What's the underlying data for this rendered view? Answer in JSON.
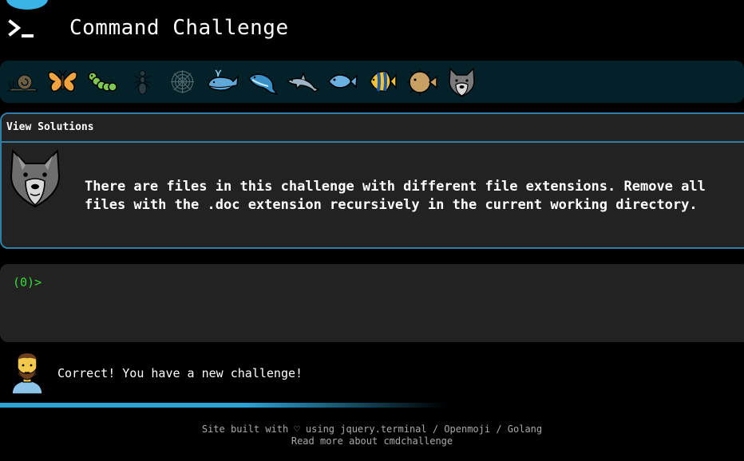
{
  "header": {
    "title": "Command Challenge",
    "logo_icon": "terminal-prompt-icon"
  },
  "levels": {
    "icons": [
      "snail-icon",
      "butterfly-icon",
      "caterpillar-icon",
      "ant-icon",
      "spider-web-icon",
      "whale-icon",
      "spouting-whale-icon",
      "dolphin-icon",
      "fish-icon",
      "tropical-fish-icon",
      "blowfish-icon",
      "wolf-icon"
    ],
    "accent": "#3ab4e6"
  },
  "challenge": {
    "solutions_label": "View Solutions",
    "avatar_icon": "wolf-icon",
    "text": "There are files in this challenge with different file extensions. Remove all\nfiles with the .doc extension recursively in the current working directory."
  },
  "terminal": {
    "prompt": "(0)>",
    "prompt_color": "#33dd33"
  },
  "message": {
    "avatar_icon": "man-beard-icon",
    "text": "Correct! You have a new challenge!"
  },
  "progress": {
    "fraction": 0.6
  },
  "footer": {
    "line1": "Site built with ♡ using jquery.terminal / Openmoji / Golang",
    "line2": "Read more about cmdchallenge"
  }
}
